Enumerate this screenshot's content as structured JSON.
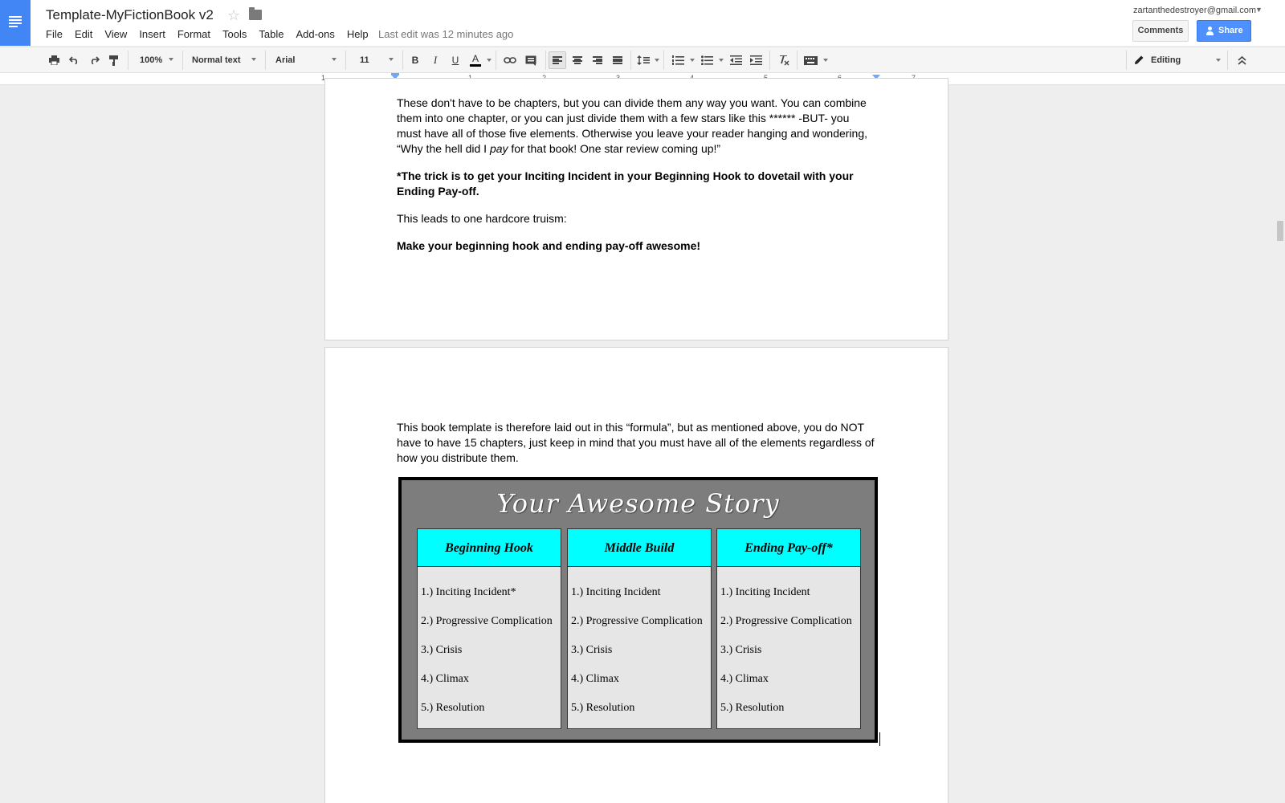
{
  "app": {
    "title": "Template-MyFictionBook v2",
    "menus": [
      "File",
      "Edit",
      "View",
      "Insert",
      "Format",
      "Tools",
      "Table",
      "Add-ons",
      "Help"
    ],
    "last_edit": "Last edit was 12 minutes ago",
    "account": "zartanthedestroyer@gmail.com",
    "comments_label": "Comments",
    "share_label": "Share",
    "accent_color": "#4285f4"
  },
  "toolbar": {
    "zoom": "100%",
    "style": "Normal text",
    "font": "Arial",
    "size": "11",
    "bold": "B",
    "italic": "I",
    "underline": "U",
    "text_color": "A",
    "mode": "Editing"
  },
  "ruler": {
    "labels": [
      "1",
      "1",
      "2",
      "3",
      "4",
      "5",
      "6",
      "7"
    ]
  },
  "document": {
    "page1": {
      "p1": "These don't have to be chapters, but you can divide them any way you want. You can combine them into one chapter, or you can just divide them with a few stars like this ******  -BUT- you must have all of those five elements. Otherwise you leave your reader hanging and wondering, “Why the hell did I ",
      "p1_italic": "pay",
      "p1_end": " for that book! One star review coming up!”",
      "p2": "*The trick is to get your Inciting Incident in your Beginning Hook to dovetail with your Ending Pay-off.",
      "p3": "This leads to one hardcore truism:",
      "p4": "Make your beginning hook and ending pay-off awesome!"
    },
    "page2": {
      "p1": "This book template is therefore laid out in this “formula”, but as mentioned above, you do NOT have to have 15 chapters, just keep in mind that you must have all of the elements regardless of how you distribute them."
    },
    "diagram": {
      "title": "Your Awesome Story",
      "columns": [
        {
          "heading": "Beginning Hook",
          "items": [
            "1.) Inciting Incident*",
            "2.) Progressive Complication",
            "3.) Crisis",
            "4.) Climax",
            "5.) Resolution"
          ]
        },
        {
          "heading": "Middle Build",
          "items": [
            "1.) Inciting Incident",
            "2.) Progressive Complication",
            "3.) Crisis",
            "4.) Climax",
            "5.) Resolution"
          ]
        },
        {
          "heading": "Ending Pay-off*",
          "items": [
            "1.) Inciting Incident",
            "2.) Progressive Complication",
            "3.) Crisis",
            "4.) Climax",
            "5.) Resolution"
          ]
        }
      ],
      "colors": {
        "frame": "#7d7d7d",
        "heading": "#00ffff",
        "body": "#e6e6e6"
      }
    }
  }
}
